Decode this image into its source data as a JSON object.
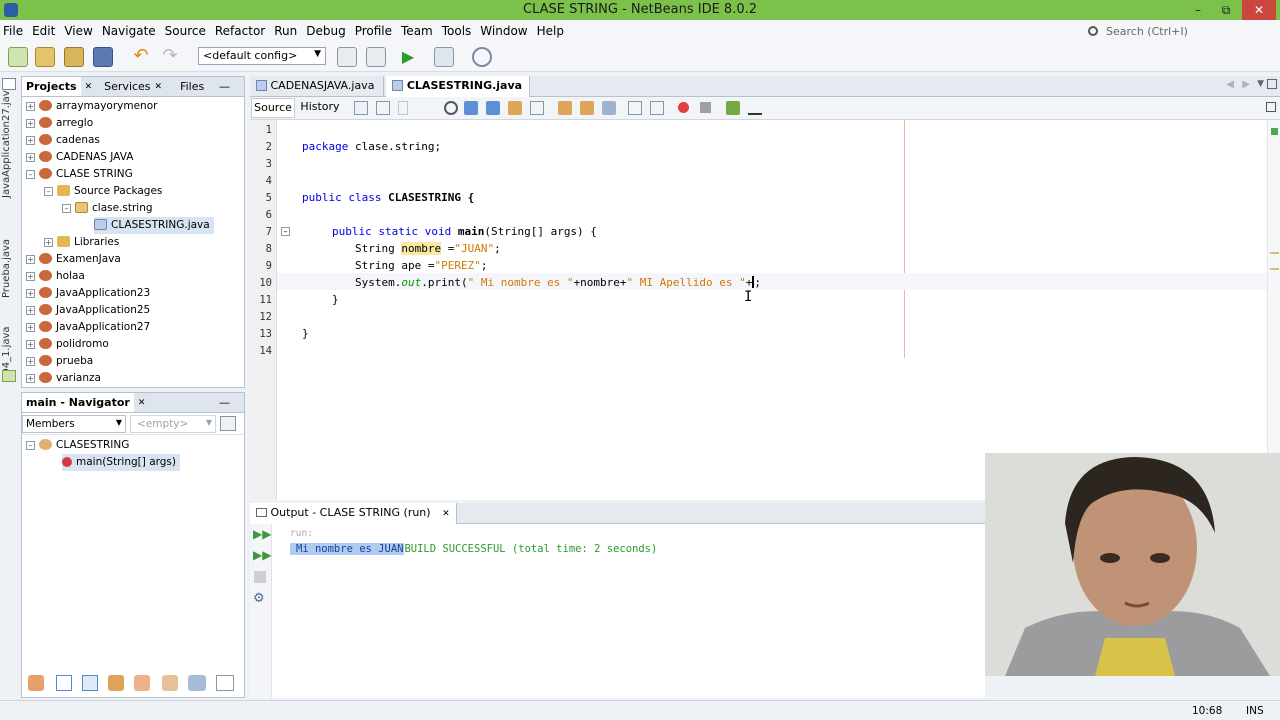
{
  "window": {
    "title": "CLASE STRING - NetBeans IDE 8.0.2"
  },
  "menu": [
    "File",
    "Edit",
    "View",
    "Navigate",
    "Source",
    "Refactor",
    "Run",
    "Debug",
    "Profile",
    "Team",
    "Tools",
    "Window",
    "Help"
  ],
  "search": {
    "placeholder": "Search (Ctrl+I)"
  },
  "toolbar": {
    "config": "<default config>"
  },
  "side_strip": [
    "JavaApplication27.java",
    "Prueba.java",
    "D4_1.java"
  ],
  "projects": {
    "tabs": [
      "Projects",
      "Services",
      "Files"
    ],
    "items": [
      {
        "label": "arraymayorymenor"
      },
      {
        "label": "arreglo"
      },
      {
        "label": "cadenas"
      },
      {
        "label": "CADENAS JAVA"
      },
      {
        "label": "CLASE STRING"
      },
      {
        "label": "Source Packages"
      },
      {
        "label": "clase.string"
      },
      {
        "label": "CLASESTRING.java"
      },
      {
        "label": "Libraries"
      },
      {
        "label": "ExamenJava"
      },
      {
        "label": "holaa"
      },
      {
        "label": "JavaApplication23"
      },
      {
        "label": "JavaApplication25"
      },
      {
        "label": "JavaApplication27"
      },
      {
        "label": "polidromo"
      },
      {
        "label": "prueba"
      },
      {
        "label": "varianza"
      }
    ]
  },
  "navigator": {
    "title": "main - Navigator",
    "filter": "Members",
    "empty": "<empty>",
    "class_name": "CLASESTRING",
    "method": "main(String[] args)"
  },
  "editor": {
    "tabs": [
      "CADENASJAVA.java",
      "CLASESTRING.java"
    ],
    "source_label": "Source",
    "history_label": "History",
    "line_numbers": [
      "1",
      "2",
      "3",
      "4",
      "5",
      "6",
      "7",
      "8",
      "9",
      "10",
      "11",
      "12",
      "13",
      "14"
    ],
    "code": {
      "l2_kw": "package",
      "l2_rest": " clase.string;",
      "l5_kw": "public class",
      "l5_rest": " CLASESTRING {",
      "l7_kw": "public static void",
      "l7_name": " main",
      "l7_rest": "(String[] args) {",
      "l8_type": "String ",
      "l8_var": "nombre",
      "l8_eq": " =",
      "l8_str": "\"JUAN\"",
      "l8_end": ";",
      "l9_type": "String ",
      "l9_var": "ape",
      "l9_eq": " =",
      "l9_str": "\"PEREZ\"",
      "l9_end": ";",
      "l10_a": "System.",
      "l10_out": "out",
      "l10_b": ".print(",
      "l10_s1": "\" Mi nombre es \"",
      "l10_c": "+nombre+",
      "l10_s2": "\" MI Apellido es \"",
      "l10_d": "+",
      "l10_end": ";",
      "l11": "}",
      "l13": "}"
    }
  },
  "output": {
    "tab": "Output - CLASE STRING (run)",
    "run_label": "run:",
    "line_selected": "Mi nombre es JUAN",
    "line_rest": "BUILD SUCCESSFUL (total time: 2 seconds)"
  },
  "status": {
    "position": "10:68",
    "mode": "INS"
  }
}
